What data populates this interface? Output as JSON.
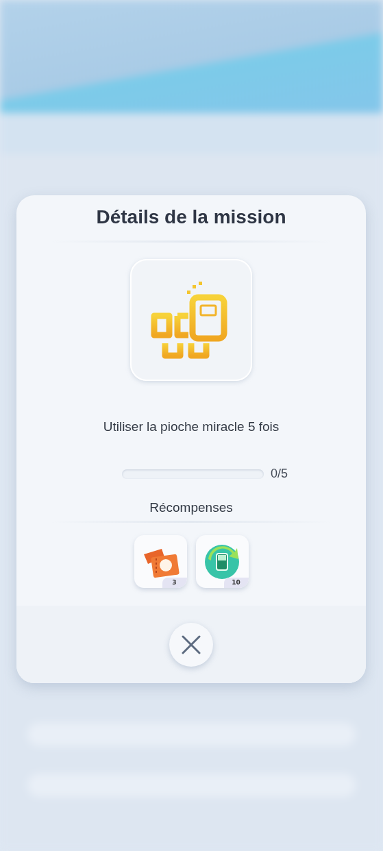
{
  "dialog": {
    "title": "Détails de la mission",
    "description": "Utiliser la pioche miracle 5 fois",
    "progress": {
      "level": 0,
      "reading": "0/5"
    },
    "rewards_heading": "Récompenses",
    "rewards": [
      {
        "kind": "ticket",
        "count": "3"
      },
      {
        "kind": "refresh",
        "count": "10"
      }
    ]
  }
}
